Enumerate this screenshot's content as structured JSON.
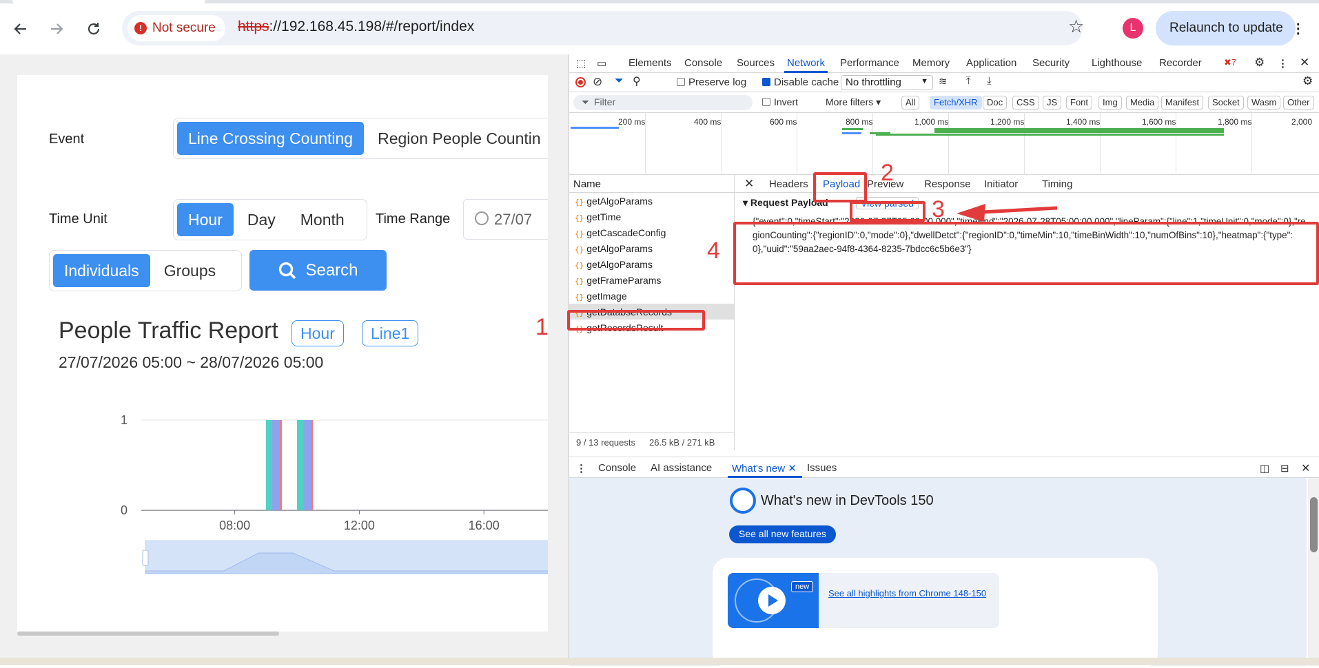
{
  "browser": {
    "security_label": "Not secure",
    "url_scheme": "https",
    "url_rest": "://192.168.45.198/#/report/index",
    "profile_initial": "L",
    "relaunch_label": "Relaunch to update"
  },
  "page": {
    "event_label": "Event",
    "event_options": [
      "Line Crossing Counting",
      "Region People Countin"
    ],
    "time_unit_label": "Time Unit",
    "time_unit_options": [
      "Hour",
      "Day",
      "Month"
    ],
    "time_range_label": "Time Range",
    "time_range_value": "27/07",
    "mode_options": [
      "Individuals",
      "Groups"
    ],
    "search_label": "Search",
    "report_title": "People Traffic Report",
    "tags": [
      "Hour",
      "Line1"
    ],
    "date_range": "27/07/2026 05:00 ~ 28/07/2026 05:00"
  },
  "chart_data": {
    "type": "bar",
    "ylim": [
      0,
      1
    ],
    "yticks": [
      "0",
      "1"
    ],
    "xticks": [
      "08:00",
      "12:00",
      "16:00"
    ],
    "x_range_hours": [
      5,
      18
    ],
    "bars": [
      {
        "hour": 9.0,
        "series": "s1",
        "value": 1
      },
      {
        "hour": 9.2,
        "series": "s2",
        "value": 1
      },
      {
        "hour": 9.45,
        "series": "s3",
        "value": 1
      },
      {
        "hour": 10.0,
        "series": "s1",
        "value": 1
      },
      {
        "hour": 10.2,
        "series": "s2",
        "value": 1
      },
      {
        "hour": 10.45,
        "series": "s3",
        "value": 1
      }
    ],
    "colors": {
      "s1": "#4fd1c5",
      "s2": "#8fa2ef",
      "s3": "#f57b7b"
    }
  },
  "devtools": {
    "tabs": [
      "Elements",
      "Console",
      "Sources",
      "Network",
      "Performance",
      "Memory",
      "Application",
      "Security",
      "Lighthouse",
      "Recorder"
    ],
    "active_tab": "Network",
    "error_count": "7",
    "toolbar": {
      "preserve_log": "Preserve log",
      "disable_cache": "Disable cache",
      "throttling": "No throttling"
    },
    "filter": {
      "placeholder": "Filter",
      "invert": "Invert",
      "more_filters": "More filters",
      "chips": [
        "All",
        "Fetch/XHR",
        "Doc",
        "CSS",
        "JS",
        "Font",
        "Img",
        "Media",
        "Manifest",
        "Socket",
        "Wasm",
        "Other"
      ],
      "active_chip": "Fetch/XHR"
    },
    "overview_ticks": [
      "200 ms",
      "400 ms",
      "600 ms",
      "800 ms",
      "1,000 ms",
      "1,200 ms",
      "1,400 ms",
      "1,600 ms",
      "1,800 ms",
      "2,000"
    ],
    "list_header": "Name",
    "requests": [
      "getAlgoParams",
      "getTime",
      "getCascadeConfig",
      "getAlgoParams",
      "getAlgoParams",
      "getFrameParams",
      "getImage",
      "getDatabseRecords",
      "getRecordsResult"
    ],
    "selected_request": "getDatabseRecords",
    "footer_requests": "9 / 13 requests",
    "footer_size": "26.5 kB / 271 kB",
    "detail_tabs": [
      "Headers",
      "Payload",
      "Preview",
      "Response",
      "Initiator",
      "Timing"
    ],
    "active_detail_tab": "Payload",
    "request_payload_label": "Request Payload",
    "view_parsed": "View parsed",
    "payload_text": "{\"event\":0,\"timeStart\":\"2026-07-27T05:00:00.000\",\"timeEnd\":\"2026-07-28T05:00:00.000\",\"lineParam\":{\"line\":1,\"timeUnit\":0,\"mode\":0},\"regionCounting\":{\"regionID\":0,\"mode\":0},\"dwellDetct\":{\"regionID\":0,\"timeMin\":10,\"timeBinWidth\":10,\"numOfBins\":10},\"heatmap\":{\"type\":0},\"uuid\":\"59aa2aec-94f8-4364-8235-7bdcc6c5b6e3\"}",
    "drawer_tabs": [
      "Console",
      "AI assistance",
      "What's new",
      "Issues"
    ],
    "active_drawer_tab": "What's new",
    "whats_new_title": "What's new in DevTools 150",
    "see_all_features": "See all new features",
    "new_badge": "new",
    "highlights_link": "See all highlights from Chrome 148-150"
  },
  "annotations": [
    "1",
    "2",
    "3",
    "4"
  ]
}
